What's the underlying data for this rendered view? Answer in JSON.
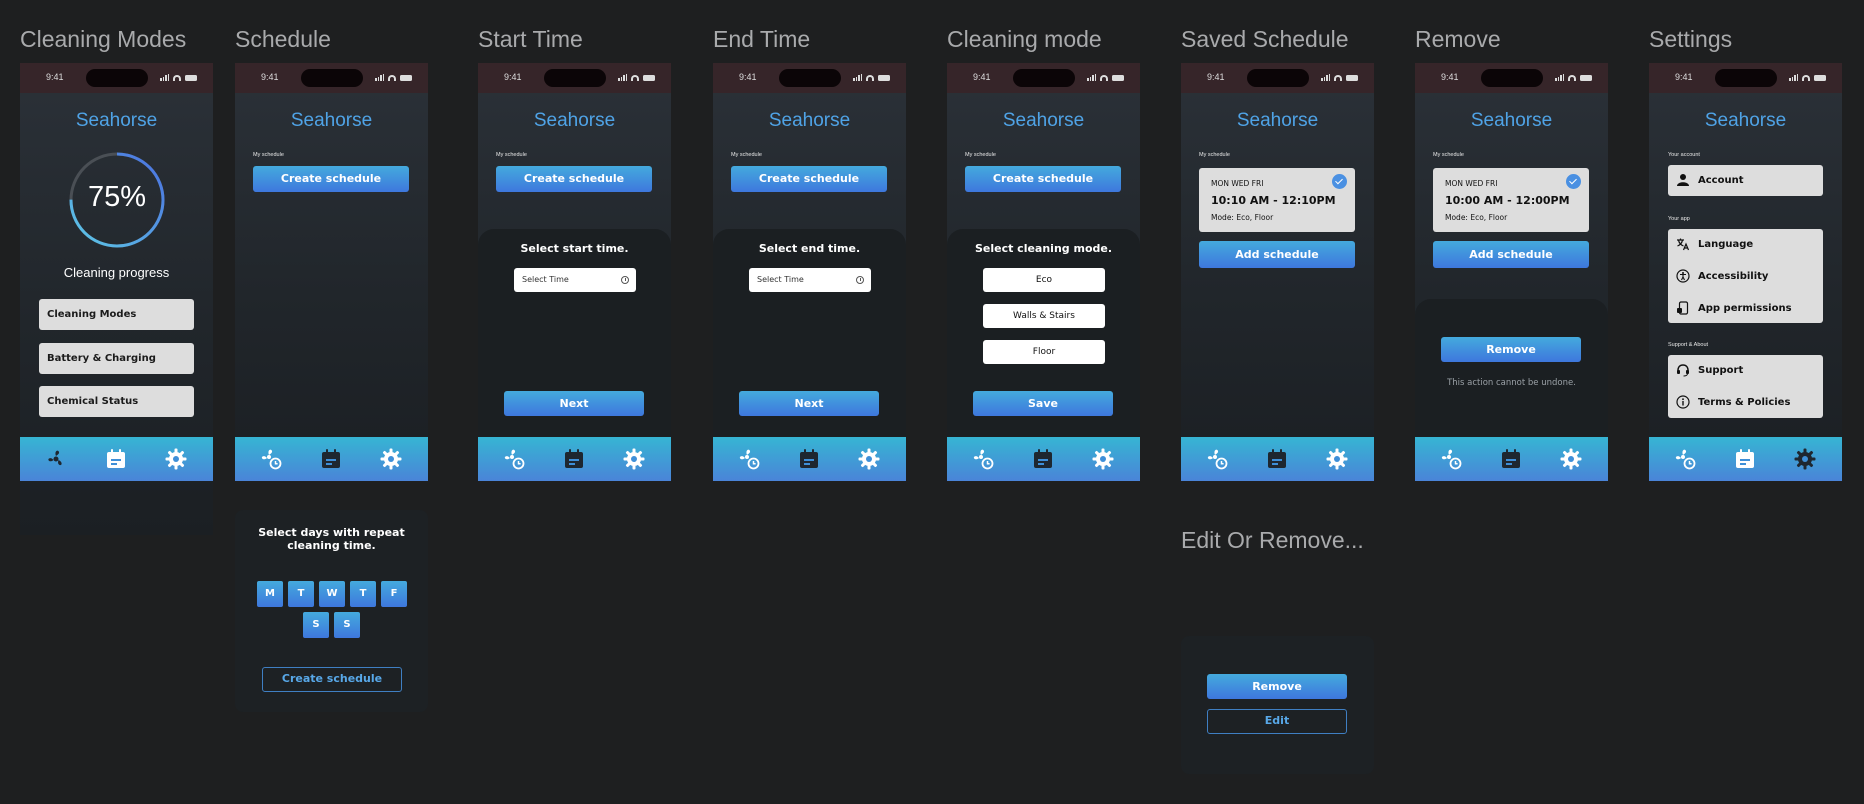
{
  "status_time": "9:41",
  "brand": "Seahorse",
  "frames": {
    "cleaning_modes": "Cleaning Modes",
    "schedule": "Schedule",
    "start_time": "Start Time",
    "end_time": "End Time",
    "cleaning_mode": "Cleaning mode",
    "saved_schedule": "Saved Schedule",
    "remove": "Remove",
    "settings": "Settings",
    "edit_or_remove": "Edit Or Remove..."
  },
  "home": {
    "progress_value": "75%",
    "progress_fraction": 0.75,
    "progress_label": "Cleaning progress",
    "menu": [
      "Cleaning Modes",
      "Battery & Charging",
      "Chemical Status"
    ]
  },
  "schedule": {
    "my_schedule": "My schedule",
    "create_schedule": "Create schedule",
    "add_schedule": "Add schedule",
    "repeat_title": "Select days with repeat cleaning time.",
    "days_row1": [
      "M",
      "T",
      "W",
      "T",
      "F"
    ],
    "days_row2": [
      "S",
      "S"
    ]
  },
  "start": {
    "title": "Select start time.",
    "placeholder": "Select Time",
    "next": "Next"
  },
  "end": {
    "title": "Select end time.",
    "placeholder": "Select Time",
    "next": "Next"
  },
  "mode": {
    "title": "Select cleaning mode.",
    "options": [
      "Eco",
      "Walls & Stairs",
      "Floor"
    ],
    "save": "Save"
  },
  "saved": {
    "days": "MON WED FRI",
    "time": "10:10 AM - 12:10PM",
    "mode": "Mode: Eco, Floor"
  },
  "remove_screen": {
    "days": "MON WED FRI",
    "time": "10:00 AM - 12:00PM",
    "mode": "Mode: Eco, Floor",
    "remove": "Remove",
    "warning": "This action cannot be undone."
  },
  "edit_panel": {
    "remove": "Remove",
    "edit": "Edit"
  },
  "settings": {
    "your_account": "Your account",
    "account": "Account",
    "your_app": "Your app",
    "app_items": [
      "Language",
      "Accessibility",
      "App permissions"
    ],
    "support_about": "Support & About",
    "support_items": [
      "Support",
      "Terms & Policies"
    ]
  },
  "colors": {
    "accent": "#4fa3e6",
    "gradient_top": "#36b5d3",
    "gradient_bottom": "#4a84d8",
    "background": "#1e1f20"
  }
}
